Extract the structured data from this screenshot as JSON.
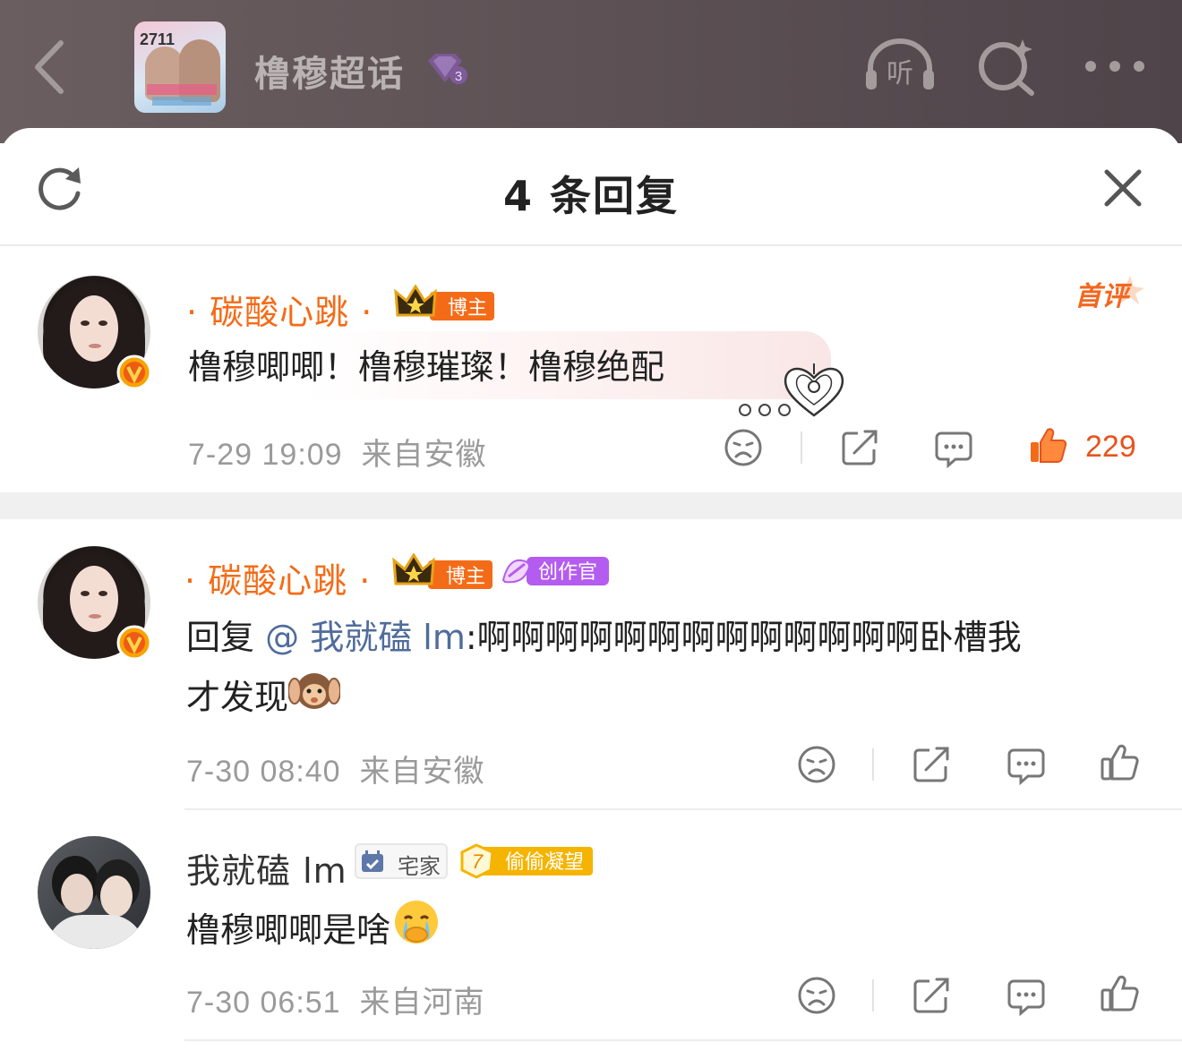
{
  "header": {
    "back_icon": "chevron-left-icon",
    "cover_text": "2711",
    "topic_title": "橹穆超话",
    "level_badge": "3",
    "listen_label": "听",
    "more_icon": "more-icon"
  },
  "sheet": {
    "title": "4 条回复",
    "refresh_icon": "refresh-icon",
    "close_icon": "close-icon"
  },
  "comments": [
    {
      "username": "· 碳酸心跳 ·",
      "badge_blogger": "博主",
      "first_comment_tag": "首评",
      "text": "橹穆唧唧！橹穆璀璨！橹穆绝配",
      "time": "7-29 19:09",
      "location": "来自安徽",
      "likes": "229",
      "liked": true
    },
    {
      "username": "· 碳酸心跳 ·",
      "badge_blogger": "博主",
      "badge_creator": "创作官",
      "reply_prefix": "回复",
      "mention": "@ 我就磕 lm",
      "text_line1": ":啊啊啊啊啊啊啊啊啊啊啊啊啊卧槽我",
      "text_line2": "才发现",
      "emoji": "🙉",
      "time": "7-30 08:40",
      "location": "来自安徽"
    },
    {
      "username": "我就磕 lm",
      "badge_home": "宅家",
      "badge_steal_level": "7",
      "badge_steal": "偷偷凝望",
      "text": "橹穆唧唧是啥",
      "emoji": "🤭",
      "time": "7-30 06:51",
      "location": "来自河南"
    }
  ],
  "colors": {
    "accent_orange": "#f46b17",
    "mention_blue": "#506c9c",
    "meta_gray": "#9a9a9a",
    "creator_purple": "#b45cf0"
  }
}
